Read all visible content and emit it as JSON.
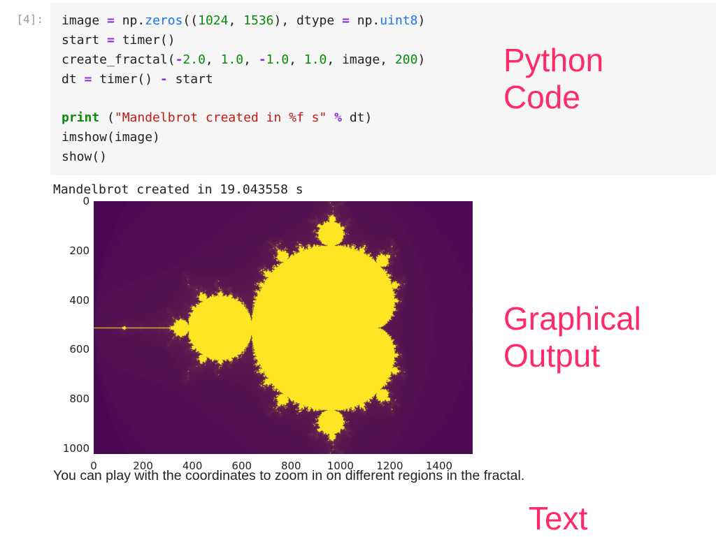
{
  "cell": {
    "prompt": "[4]:",
    "code_tokens": [
      {
        "t": "image ",
        "c": ""
      },
      {
        "t": "=",
        "c": "tok-op"
      },
      {
        "t": " np",
        "c": ""
      },
      {
        "t": ".",
        "c": ""
      },
      {
        "t": "zeros",
        "c": "tok-attr"
      },
      {
        "t": "((",
        "c": ""
      },
      {
        "t": "1024",
        "c": "tok-num"
      },
      {
        "t": ", ",
        "c": ""
      },
      {
        "t": "1536",
        "c": "tok-num"
      },
      {
        "t": "), dtype ",
        "c": ""
      },
      {
        "t": "=",
        "c": "tok-op"
      },
      {
        "t": " np",
        "c": ""
      },
      {
        "t": ".",
        "c": ""
      },
      {
        "t": "uint8",
        "c": "tok-attr"
      },
      {
        "t": ")\n",
        "c": ""
      },
      {
        "t": "start ",
        "c": ""
      },
      {
        "t": "=",
        "c": "tok-op"
      },
      {
        "t": " timer()\n",
        "c": ""
      },
      {
        "t": "create_fractal(",
        "c": ""
      },
      {
        "t": "-",
        "c": "tok-op"
      },
      {
        "t": "2.0",
        "c": "tok-num"
      },
      {
        "t": ", ",
        "c": ""
      },
      {
        "t": "1.0",
        "c": "tok-num"
      },
      {
        "t": ", ",
        "c": ""
      },
      {
        "t": "-",
        "c": "tok-op"
      },
      {
        "t": "1.0",
        "c": "tok-num"
      },
      {
        "t": ", ",
        "c": ""
      },
      {
        "t": "1.0",
        "c": "tok-num"
      },
      {
        "t": ", image, ",
        "c": ""
      },
      {
        "t": "200",
        "c": "tok-num"
      },
      {
        "t": ")\n",
        "c": ""
      },
      {
        "t": "dt ",
        "c": ""
      },
      {
        "t": "=",
        "c": "tok-op"
      },
      {
        "t": " timer() ",
        "c": ""
      },
      {
        "t": "-",
        "c": "tok-op"
      },
      {
        "t": " start\n",
        "c": ""
      },
      {
        "t": "\n",
        "c": ""
      },
      {
        "t": "print",
        "c": "tok-kw"
      },
      {
        "t": " (",
        "c": ""
      },
      {
        "t": "\"Mandelbrot created in %f s\"",
        "c": "tok-str"
      },
      {
        "t": " ",
        "c": ""
      },
      {
        "t": "%",
        "c": "tok-op"
      },
      {
        "t": " dt)\n",
        "c": ""
      },
      {
        "t": "imshow(image)\n",
        "c": ""
      },
      {
        "t": "show()",
        "c": ""
      }
    ],
    "stdout": "Mandelbrot created in 19.043558 s"
  },
  "chart_data": {
    "type": "heatmap",
    "title": "",
    "xlabel": "",
    "ylabel": "",
    "xlim": [
      0,
      1536
    ],
    "ylim": [
      0,
      1024
    ],
    "xticks": [
      0,
      200,
      400,
      600,
      800,
      1000,
      1200,
      1400
    ],
    "yticks": [
      0,
      200,
      400,
      600,
      800,
      1000
    ],
    "description": "Mandelbrot set escape-time image, 1024×1536, viridis colormap; interior rendered yellow, exterior deep purple.",
    "real_range": [
      -2.0,
      1.0
    ],
    "imag_range": [
      -1.0,
      1.0
    ],
    "max_iter": 200
  },
  "markdown": {
    "text": "You can play with the coordinates to zoom in on different regions in the fractal."
  },
  "annotations": {
    "code": "Python\nCode",
    "plot": "Graphical\nOutput",
    "text": "Text"
  },
  "colors": {
    "annotation": "#ff2a68",
    "viridis_low": "#440154",
    "viridis_high": "#fde725"
  }
}
